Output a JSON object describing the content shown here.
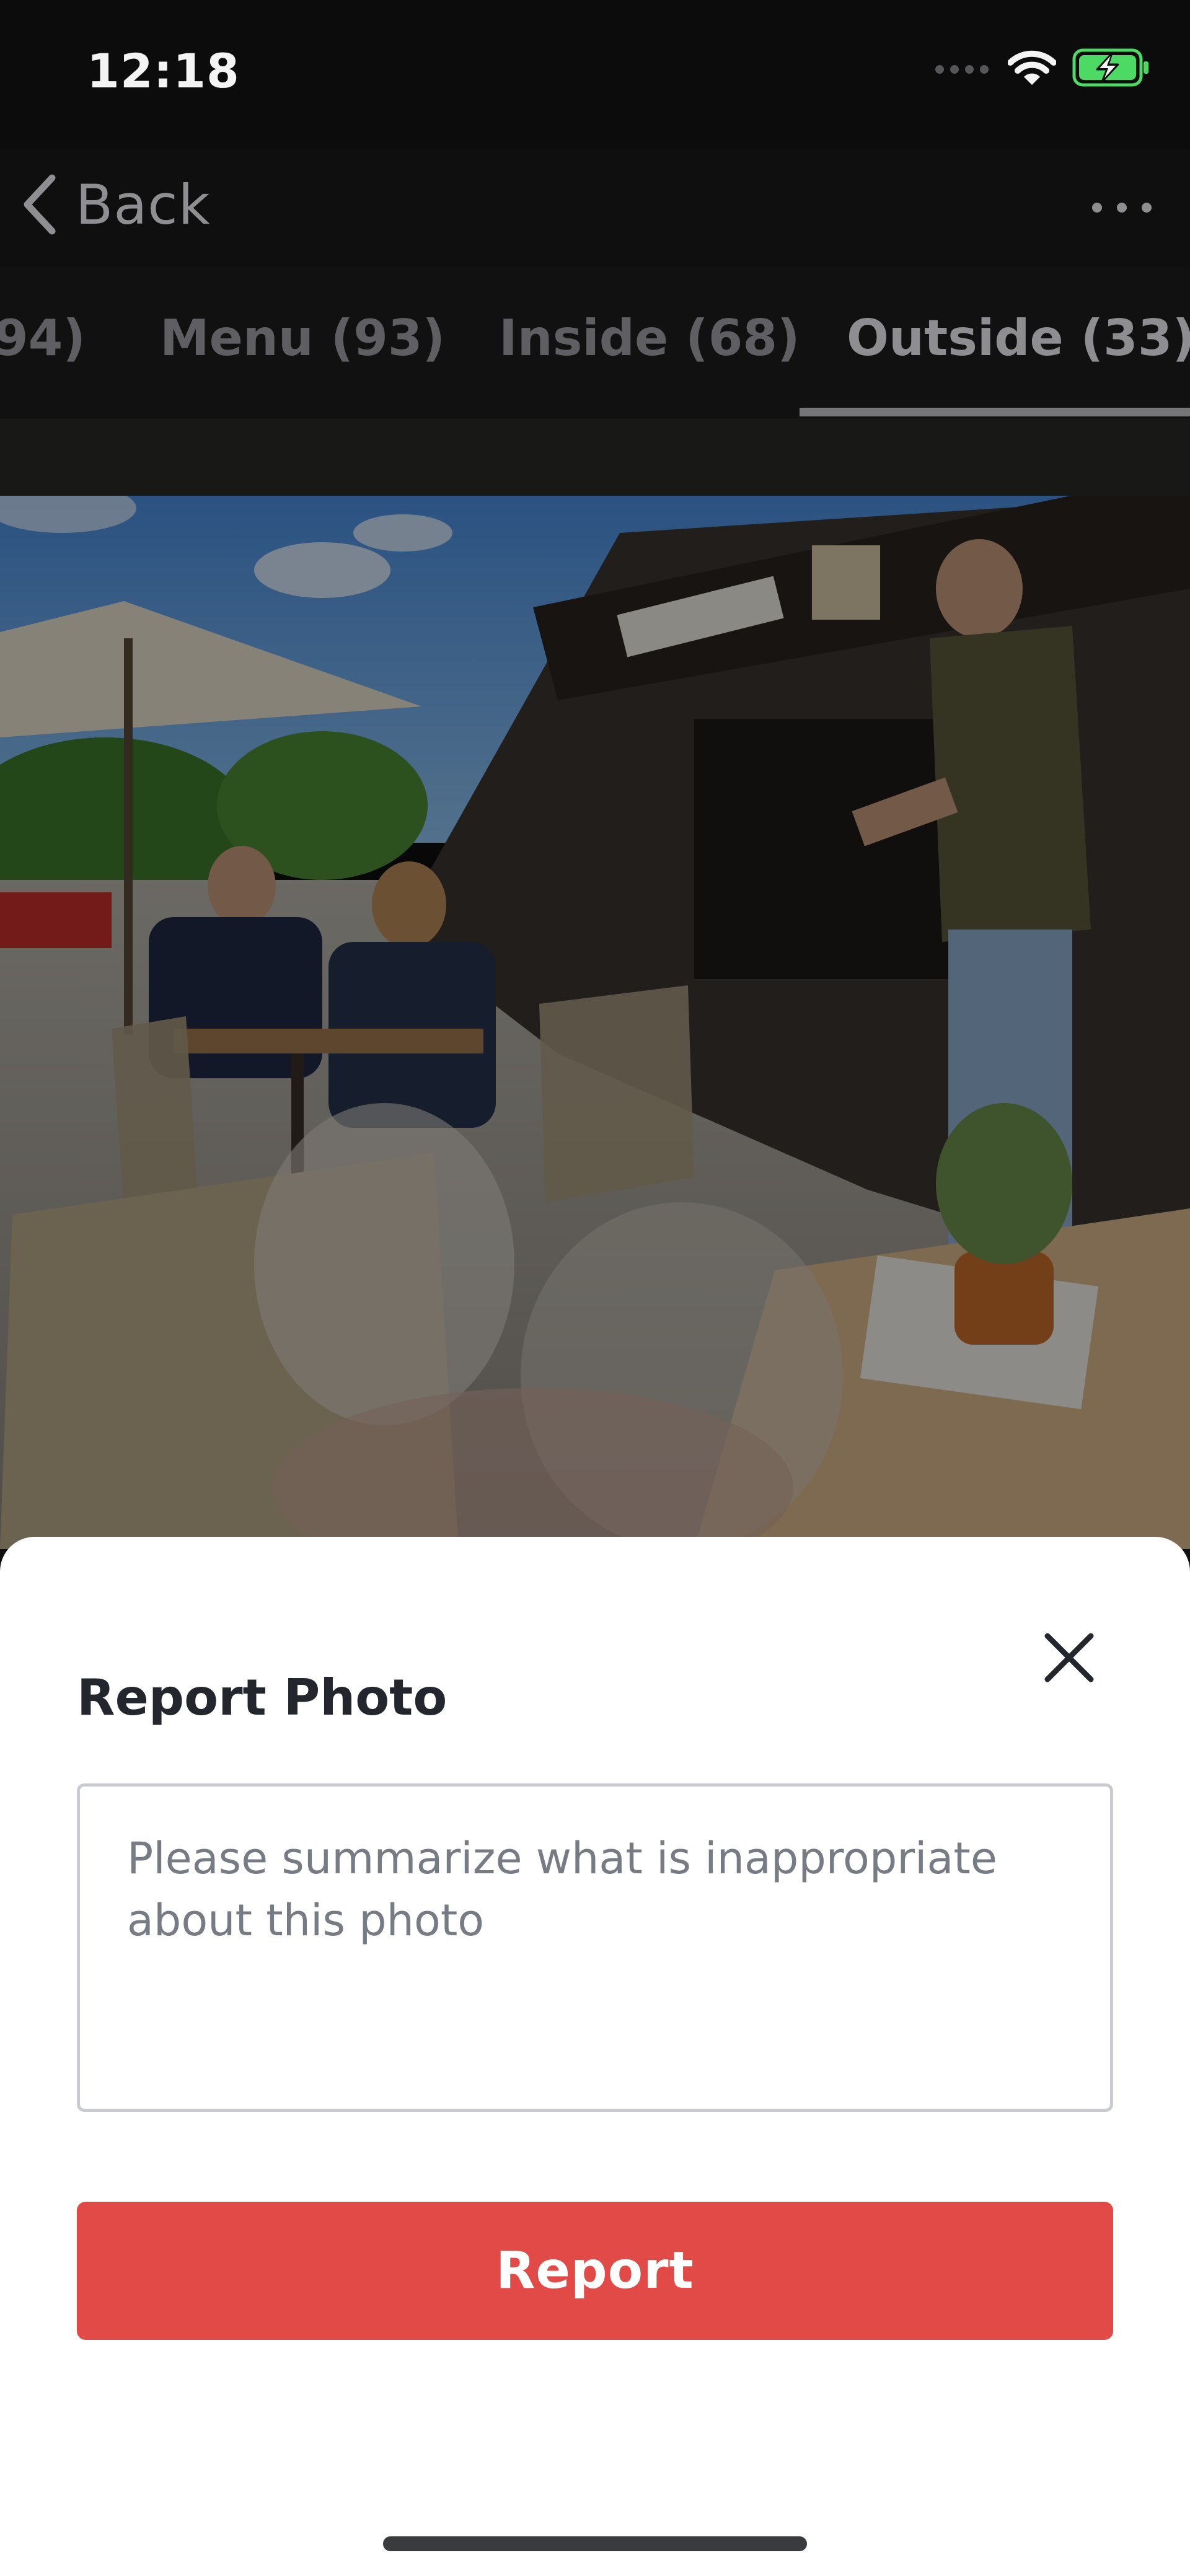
{
  "status_bar": {
    "time": "12:18"
  },
  "nav": {
    "back_label": "Back",
    "back_icon": "chevron-left-icon",
    "more_icon": "more-horizontal-icon"
  },
  "tabs": [
    {
      "label": "94)",
      "active": false
    },
    {
      "label": "Menu (93)",
      "active": false
    },
    {
      "label": "Inside (68)",
      "active": false
    },
    {
      "label": "Outside (33)",
      "active": true
    }
  ],
  "photo": {
    "alt": "Outdoor patio dining"
  },
  "report_sheet": {
    "title": "Report Photo",
    "close_icon": "close-icon",
    "textarea_value": "",
    "textarea_placeholder": "Please summarize what is inappropriate about this photo",
    "submit_label": "Report"
  },
  "colors": {
    "accent": "#e24a47",
    "battery": "#4cd964"
  }
}
